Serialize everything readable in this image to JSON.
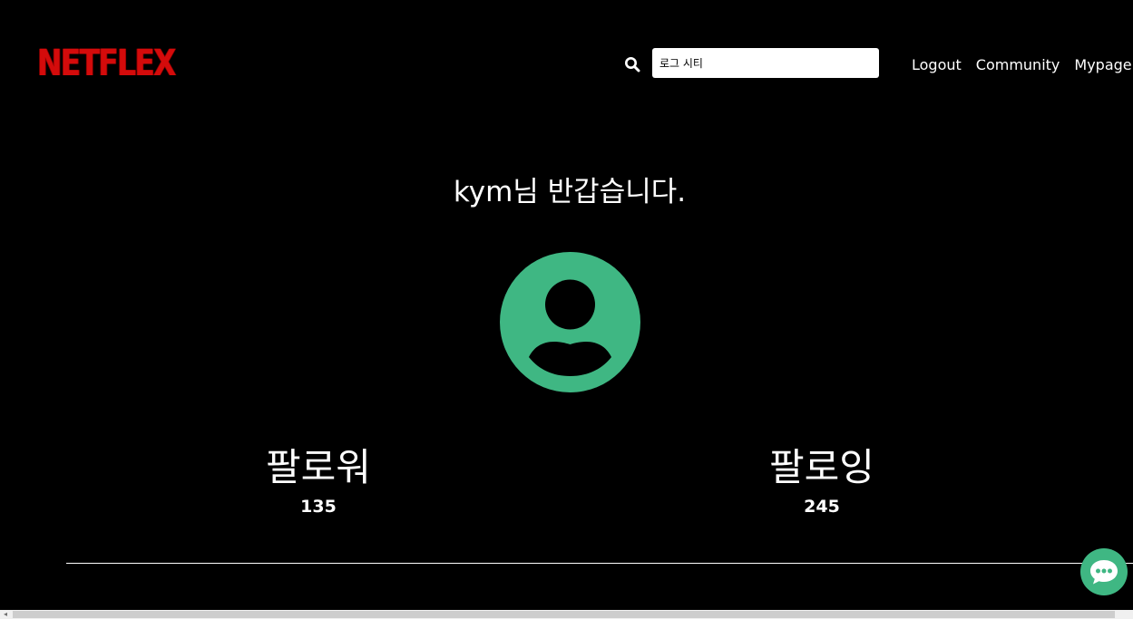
{
  "header": {
    "logo_text": "NETFLEX",
    "search": {
      "value": "로그 시티",
      "placeholder": ""
    },
    "nav": [
      {
        "label": "Logout"
      },
      {
        "label": "Community"
      },
      {
        "label": "Mypage"
      }
    ]
  },
  "profile": {
    "greeting": "kym님 반갑습니다.",
    "followers_label": "팔로워",
    "followers_count": "135",
    "following_label": "팔로잉",
    "following_count": "245"
  },
  "icons": {
    "search": "search-icon",
    "avatar": "user-avatar-icon",
    "chat": "chat-bubble-icon"
  },
  "colors": {
    "background": "#000000",
    "logo": "#d40b0b",
    "accent": "#3fb783",
    "text": "#ffffff"
  }
}
